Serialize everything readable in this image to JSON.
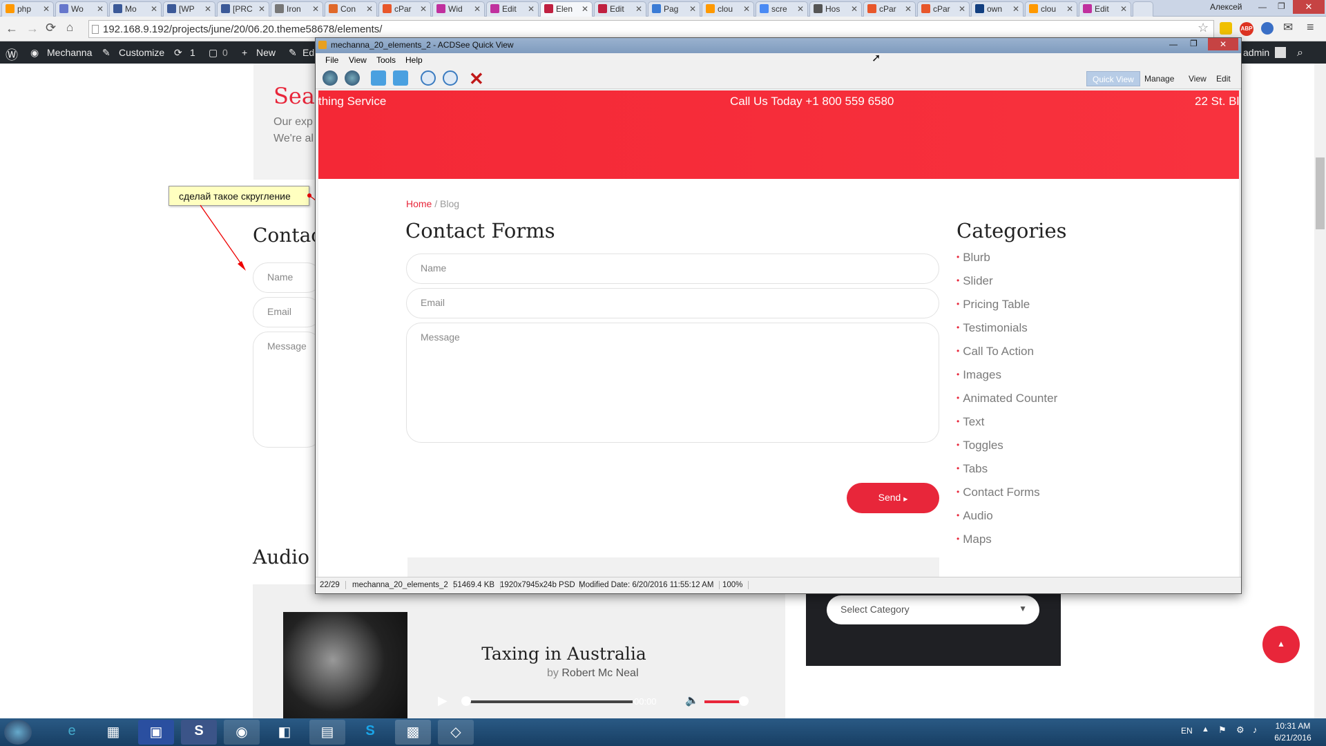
{
  "browser": {
    "tabs": [
      "php",
      "Wo",
      "Mo",
      "[WP",
      "[PRC",
      "Iron",
      "Con",
      "cPar",
      "Wid",
      "Edit",
      "Elen",
      "Edit",
      "Pag",
      "clou",
      "scre",
      "Hos",
      "cPar",
      "cPar",
      "own",
      "clou",
      "Edit"
    ],
    "tab_colors": [
      "#ff9900",
      "#6677cc",
      "#3b5998",
      "#3b5998",
      "#3b5998",
      "#777",
      "#e0692a",
      "#e8572b",
      "#c0309e",
      "#c0309e",
      "#c02040",
      "#c02040",
      "#3a7bd5",
      "#ff9900",
      "#4a8af4",
      "#555",
      "#e8572b",
      "#e8572b",
      "#123f80",
      "#ff9900",
      "#c0309e"
    ],
    "user": "Алексей",
    "address": "192.168.9.192/projects/june/20/06.20.theme58678/elements/"
  },
  "wpbar": {
    "site": "Mechanna",
    "customize": "Customize",
    "updates": "1",
    "comments": "0",
    "new": "New",
    "edit": "Ed",
    "howdy": "admin"
  },
  "bgpage": {
    "heading_part": "Sea",
    "p1": "Our exp",
    "p2": "We're al",
    "contact_part": "Contac",
    "name": "Name",
    "email": "Email",
    "message": "Message",
    "audio_part": "Audio",
    "audio_title": "Taxing in Australia",
    "by": "by",
    "author": "Robert Mc Neal",
    "time": "00:00",
    "select": "Select Category"
  },
  "note": "сделай такое скругление",
  "acdsee": {
    "title": "mechanna_20_elements_2 - ACDSee Quick View",
    "menu": [
      "File",
      "View",
      "Tools",
      "Help"
    ],
    "modes": [
      "Quick View",
      "Manage",
      "View",
      "Edit"
    ],
    "banner": {
      "left": "thing Service",
      "center": "Call Us Today +1 800 559 6580",
      "right": "22 St. Bl"
    },
    "breadcrumb_home": "Home",
    "breadcrumb_sep": "/ Blog",
    "form_title": "Contact Forms",
    "name": "Name",
    "email": "Email",
    "message": "Message",
    "send": "Send",
    "cat_title": "Categories",
    "categories": [
      "Blurb",
      "Slider",
      "Pricing Table",
      "Testimonials",
      "Call To Action",
      "Images",
      "Animated Counter",
      "Text",
      "Toggles",
      "Tabs",
      "Contact Forms",
      "Audio",
      "Maps"
    ],
    "status": {
      "index": "22/29",
      "file": "mechanna_20_elements_2",
      "size": "51469.4 KB",
      "dims": "1920x7945x24b PSD",
      "modified": "Modified Date: 6/20/2016 11:55:12 AM",
      "zoom": "100%"
    }
  },
  "taskbar": {
    "lang": "EN",
    "time": "10:31 AM",
    "date": "6/21/2016"
  }
}
